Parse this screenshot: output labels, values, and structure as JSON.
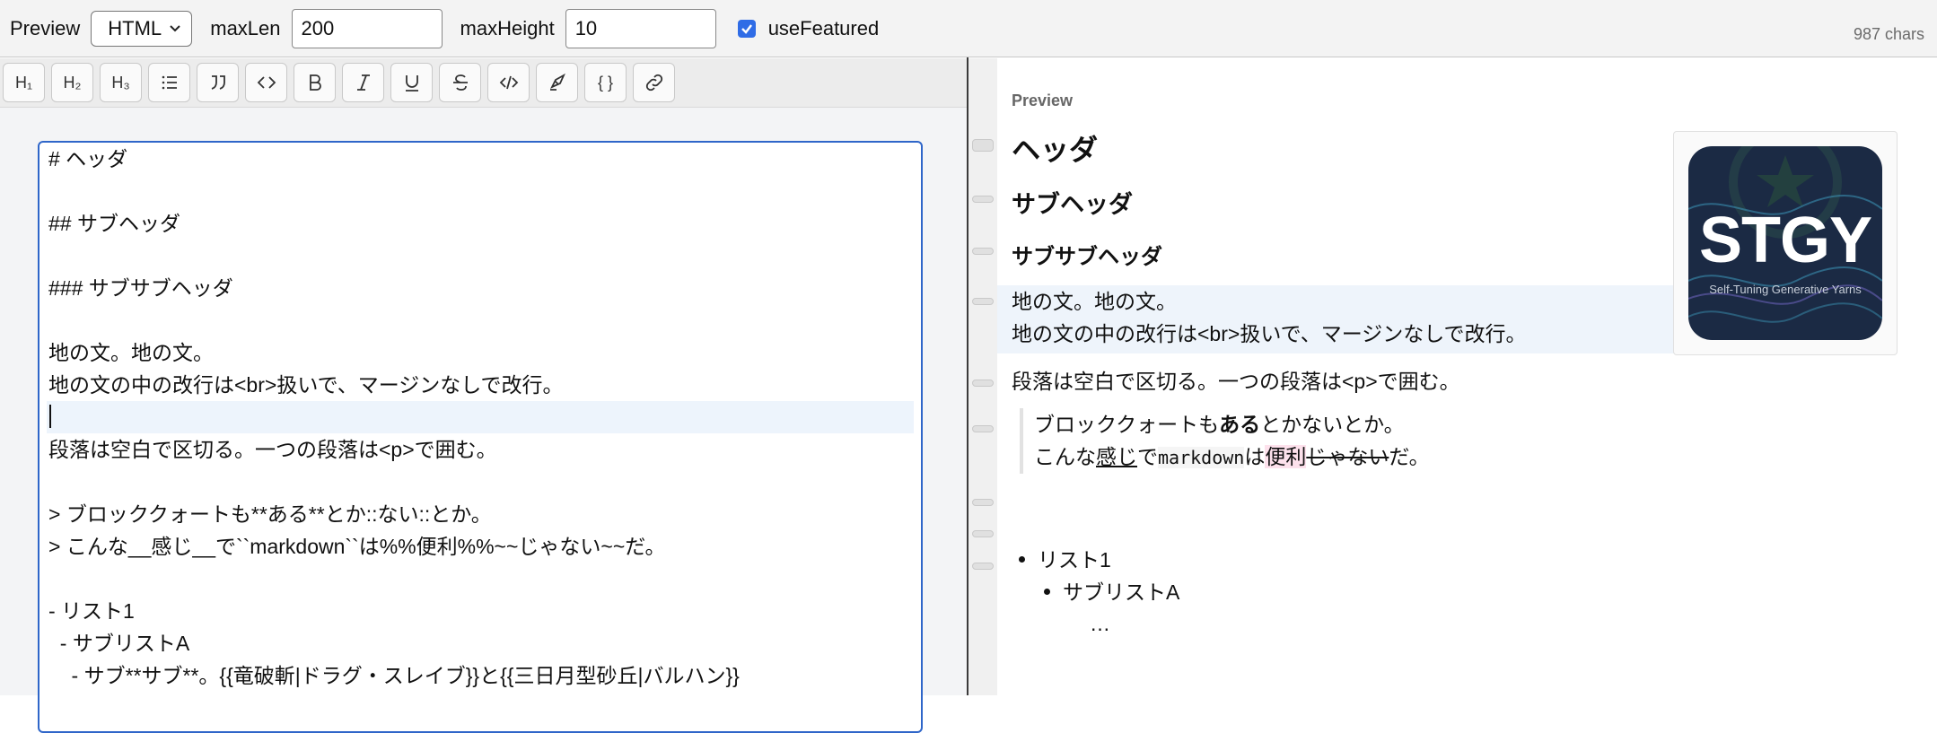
{
  "topbar": {
    "preview_label": "Preview",
    "mode_value": "HTML",
    "maxlen_label": "maxLen",
    "maxlen_value": "200",
    "maxheight_label": "maxHeight",
    "maxheight_value": "10",
    "usefeatured_label": "useFeatured",
    "usefeatured_checked": true,
    "char_count": "987 chars"
  },
  "toolbar": {
    "buttons": [
      "H1",
      "H2",
      "H3",
      "list",
      "quote",
      "code",
      "bold",
      "italic",
      "underline",
      "strikethrough",
      "inline-code",
      "highlight",
      "braces",
      "link"
    ],
    "h1": "H₁",
    "h2": "H₂",
    "h3": "H₃",
    "braces": "{ }"
  },
  "editor": {
    "lines": [
      "# ヘッダ",
      "",
      "## サブヘッダ",
      "",
      "### サブサブヘッダ",
      "",
      "地の文。地の文。",
      "地の文の中の改行は<br>扱いで、マージンなしで改行。",
      "",
      "段落は空白で区切る。一つの段落は<p>で囲む。",
      "",
      "> ブロッククォートも**ある**とか::ない::とか。",
      "> こんな__感じ__で``markdown``は%%便利%%~~じゃない~~だ。",
      "",
      "- リスト1",
      "  - サブリストA",
      "    - サブ**サブ**。{{竜破斬|ドラグ・スレイブ}}と{{三日月型砂丘|バルハン}}"
    ]
  },
  "preview": {
    "label": "Preview",
    "h1": "ヘッダ",
    "h2": "サブヘッダ",
    "h3": "サブサブヘッダ",
    "para1_line1": "地の文。地の文。",
    "para1_line2": "地の文の中の改行は<br>扱いで、マージンなしで改行。",
    "para2": "段落は空白で区切る。一つの段落は<p>で囲む。",
    "quote": {
      "l1_a": "ブロッククォートも",
      "l1_bold": "ある",
      "l1_b": "とかないとか。",
      "l2_a": "こんな",
      "l2_u": "感じ",
      "l2_b": "で",
      "l2_code": "markdown",
      "l2_c": "は",
      "l2_mark": "便利",
      "l2_strike": "じゃない",
      "l2_d": "だ。"
    },
    "list_item_1": "リスト1",
    "list_item_sub": "サブリストA",
    "ellipsis": "…",
    "logo": {
      "title": "STGY",
      "subtitle": "Self-Tuning Generative Yarns",
      "bg": "#1b2a44"
    }
  },
  "colors": {
    "accent": "#2f66c9",
    "highlight": "#edf4fc",
    "mark": "#fde1ec"
  }
}
